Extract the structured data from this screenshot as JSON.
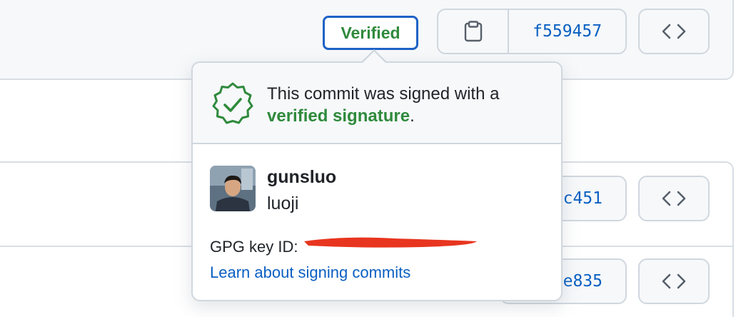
{
  "badge": {
    "label": "Verified"
  },
  "commits": [
    {
      "sha": "f559457"
    },
    {
      "sha": "c451"
    },
    {
      "sha": "e835"
    }
  ],
  "icons": {
    "copy": "clipboard-icon",
    "browse": "code-icon",
    "verified": "verified-badge-icon"
  },
  "popover": {
    "message_prefix": "This commit was signed with a",
    "message_highlight": "verified signature",
    "message_suffix": ".",
    "username": "gunsluo",
    "full_name": "luoji",
    "gpg_label": "GPG key ID:",
    "learn_link": "Learn about signing commits"
  },
  "colors": {
    "verified_green": "#2f8a3c",
    "link_blue": "#0a5fc2",
    "focus_blue": "#1f62c6",
    "redaction_red": "#e8351f"
  }
}
